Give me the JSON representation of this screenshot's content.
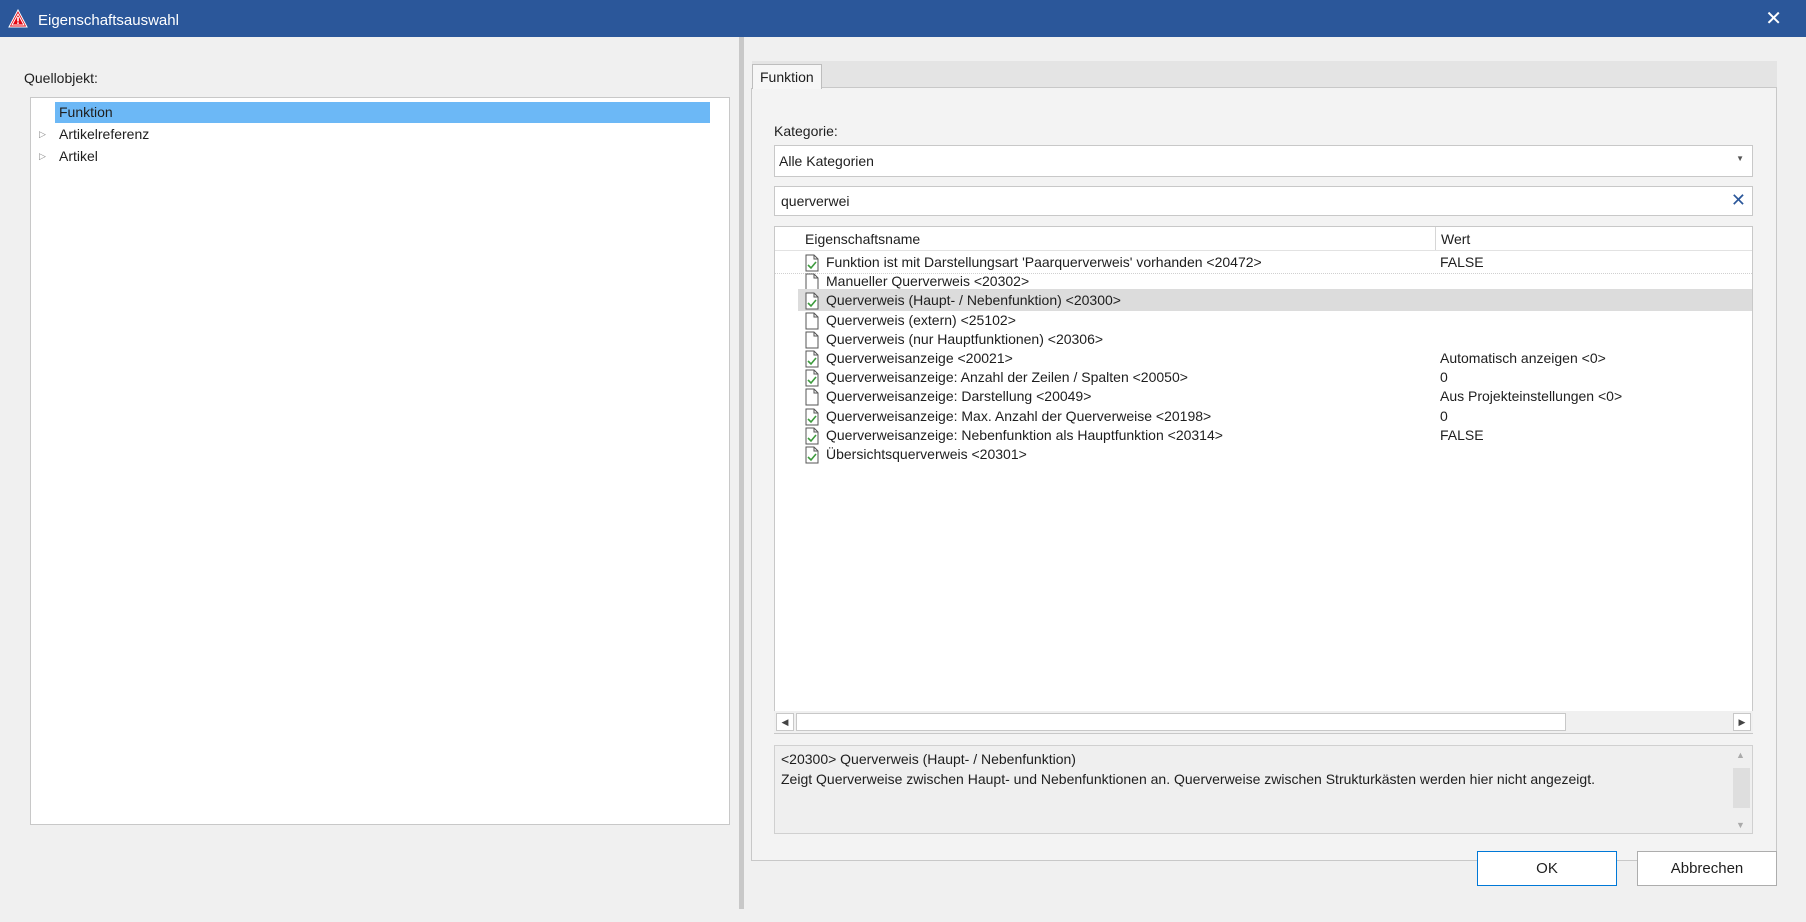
{
  "window": {
    "title": "Eigenschaftsauswahl",
    "close_glyph": "✕",
    "icon": "warning-triangle-icon"
  },
  "source": {
    "label": "Quellobjekt:",
    "tree": [
      {
        "label": "Funktion",
        "expandable": false,
        "selected": true
      },
      {
        "label": "Artikelreferenz",
        "expandable": true,
        "selected": false
      },
      {
        "label": "Artikel",
        "expandable": true,
        "selected": false
      }
    ]
  },
  "tabs": [
    {
      "label": "Funktion",
      "active": true
    }
  ],
  "category": {
    "label": "Kategorie:",
    "value": "Alle Kategorien"
  },
  "search": {
    "value": "querverwei",
    "clear_glyph": "✕"
  },
  "grid": {
    "columns": [
      "Eigenschaftsname",
      "Wert"
    ],
    "rows": [
      {
        "name": "Funktion ist mit Darstellungsart 'Paarquerverweis' vorhanden <20472>",
        "value": "FALSE",
        "checked": true,
        "selected": false
      },
      {
        "name": "Manueller Querverweis <20302>",
        "value": "",
        "checked": false,
        "selected": false
      },
      {
        "name": "Querverweis (Haupt- / Nebenfunktion) <20300>",
        "value": "",
        "checked": true,
        "selected": true
      },
      {
        "name": "Querverweis (extern) <25102>",
        "value": "",
        "checked": false,
        "selected": false
      },
      {
        "name": "Querverweis (nur Hauptfunktionen) <20306>",
        "value": "",
        "checked": false,
        "selected": false
      },
      {
        "name": "Querverweisanzeige <20021>",
        "value": "Automatisch anzeigen <0>",
        "checked": true,
        "selected": false
      },
      {
        "name": "Querverweisanzeige: Anzahl der Zeilen / Spalten <20050>",
        "value": "0",
        "checked": true,
        "selected": false
      },
      {
        "name": "Querverweisanzeige: Darstellung <20049>",
        "value": "Aus Projekteinstellungen <0>",
        "checked": false,
        "selected": false
      },
      {
        "name": "Querverweisanzeige: Max. Anzahl der Querverweise <20198>",
        "value": "0",
        "checked": true,
        "selected": false
      },
      {
        "name": "Querverweisanzeige: Nebenfunktion als Hauptfunktion <20314>",
        "value": "FALSE",
        "checked": true,
        "selected": false
      },
      {
        "name": "Übersichtsquerverweis <20301>",
        "value": "",
        "checked": true,
        "selected": false
      }
    ]
  },
  "description": {
    "title": "<20300> Querverweis (Haupt- / Nebenfunktion)",
    "text": "Zeigt Querverweise zwischen Haupt- und Nebenfunktionen an. Querverweise zwischen Strukturkästen werden hier nicht angezeigt."
  },
  "buttons": {
    "ok": "OK",
    "cancel": "Abbrechen"
  },
  "colors": {
    "titlebar": "#2b579a",
    "selection": "#6cb8f6",
    "accent": "#0078d7",
    "icon_red": "#e30613"
  }
}
